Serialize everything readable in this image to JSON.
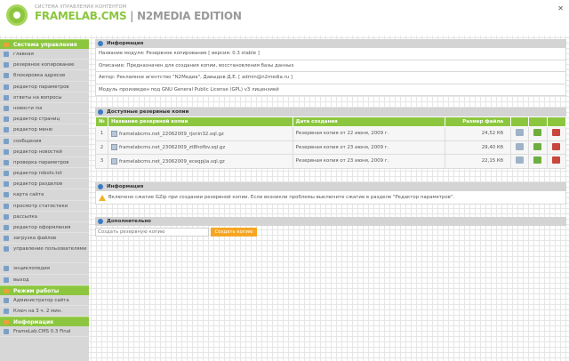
{
  "header": {
    "subtitle": "СИСТЕМА УПРАВЛЕНИЯ КОНТЕНТОМ",
    "title_brand": "FRAMELAB.CMS",
    "title_edition": " | N2MEDIA EDITION",
    "close_label": "✕"
  },
  "sidebar": {
    "sections": [
      {
        "label": "Система управления",
        "items": [
          "главная",
          "резервное копирование",
          "блокировка адресов",
          "редактор параметров",
          "ответы на вопросы",
          "новости rss",
          "редактор страниц",
          "редактор меню",
          "сообщения",
          "редактор новостей",
          "проверка параметров",
          "редактор robots.txt",
          "редактор разделов",
          "карта сайта",
          "просмотр статистики",
          "рассылка",
          "редактор оформления",
          "загрузка файлов",
          "управление пользователями",
          "энциклопедия",
          "выход"
        ]
      },
      {
        "label": "Режим работы",
        "items": [
          "Администратор сайта",
          "Ключ на 3 ч. 2 мин."
        ]
      },
      {
        "label": "Информация",
        "items": [
          "FrameLab.CMS 0.3 Final"
        ]
      }
    ]
  },
  "info_panel": {
    "title": "Информация",
    "rows": [
      "Название модуля: Резервное копирование [ версия: 0.3 stable ]",
      "Описание: Предназначен для создания копии, восстановления базы данных",
      "Автор: Рекламное агентство \"N2Медиа\", Давыдов Д.Е. [ admin@n2media.ru ]",
      "Модуль произведен под GNU General Public License (GPL) v3 лицензией"
    ]
  },
  "backups_panel": {
    "title": "Доступные резервные копии",
    "columns": [
      "№",
      "Название резервной копии",
      "Дата создания",
      "Размер файла"
    ],
    "rows": [
      {
        "num": "1",
        "name": "framelabcms.net_22062009_rjsnin32.sql.gz",
        "date": "Резервная копия от 22 июня, 2009 г.",
        "size": "24,52 Кб"
      },
      {
        "num": "2",
        "name": "framelabcms.net_23062009_zt8hofbv.sql.gz",
        "date": "Резервная копия от 23 июня, 2009 г.",
        "size": "29,40 Кб"
      },
      {
        "num": "3",
        "name": "framelabcms.net_23062009_eceqpjia.sql.gz",
        "date": "Резервная копия от 23 июня, 2009 г.",
        "size": "22,15 Кб"
      }
    ]
  },
  "notice_panel": {
    "title": "Информация",
    "text": "Включено сжатие GZip при создании резервной копии. Если возникли проблемы выключите сжатие в разделе \"Редактор параметров\"."
  },
  "extra_panel": {
    "title": "Дополнительно",
    "input_value": "Создать резервную копию",
    "button_label": "Создать копию"
  },
  "colors": {
    "accent": "#8cc63f",
    "sidebar_bg": "#d7d7d7",
    "button": "#f5a623"
  }
}
